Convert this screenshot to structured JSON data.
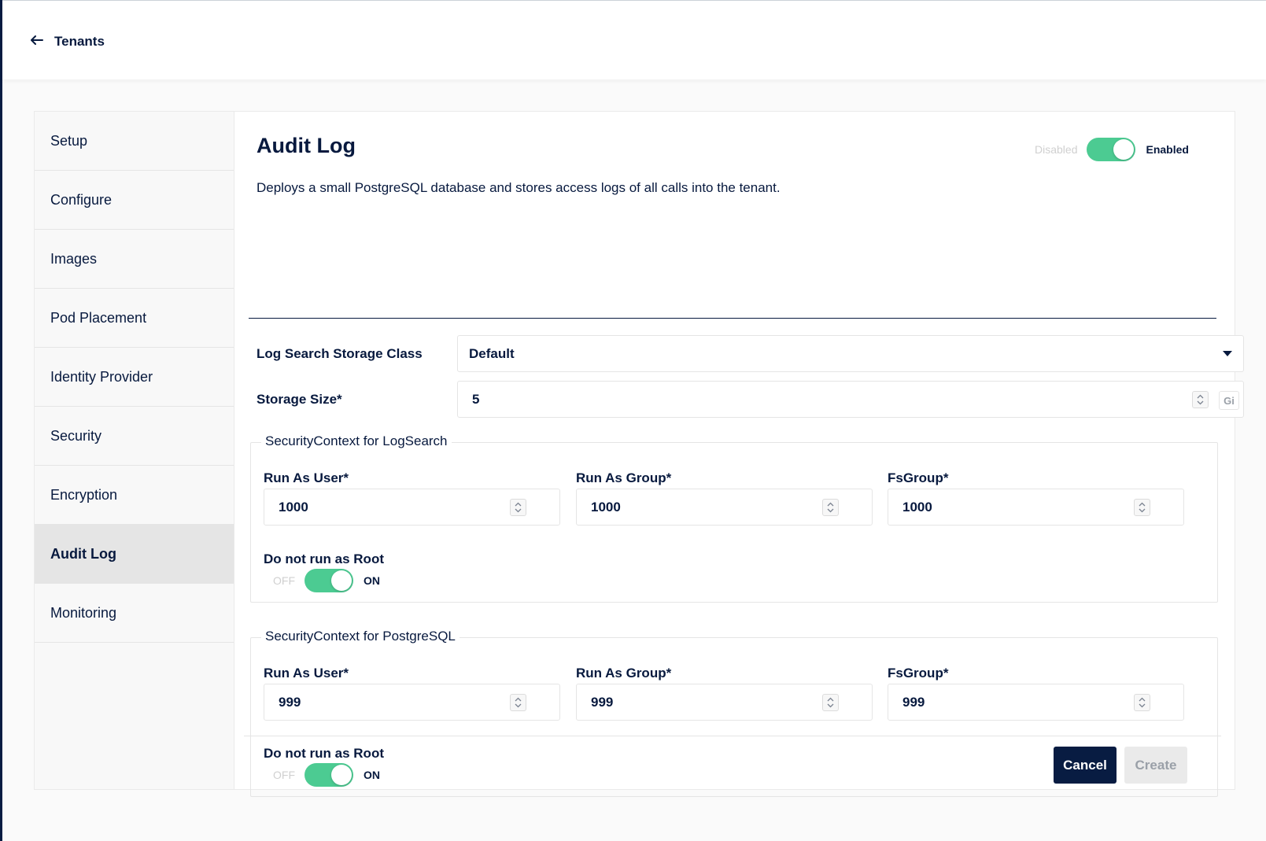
{
  "header": {
    "back_label": "Tenants"
  },
  "sidebar": {
    "items": [
      {
        "label": "Setup"
      },
      {
        "label": "Configure"
      },
      {
        "label": "Images"
      },
      {
        "label": "Pod Placement"
      },
      {
        "label": "Identity Provider"
      },
      {
        "label": "Security"
      },
      {
        "label": "Encryption"
      },
      {
        "label": "Audit Log",
        "active": true
      },
      {
        "label": "Monitoring"
      }
    ]
  },
  "main": {
    "title": "Audit Log",
    "description": "Deploys a small PostgreSQL database and stores access logs of all calls into the tenant.",
    "enable_toggle": {
      "off_label": "Disabled",
      "on_label": "Enabled",
      "value": true
    },
    "storage_class": {
      "label": "Log Search Storage Class",
      "value": "Default"
    },
    "storage_size": {
      "label": "Storage Size*",
      "value": "5",
      "unit": "Gi"
    },
    "logsearch_context": {
      "legend": "SecurityContext for LogSearch",
      "run_as_user": {
        "label": "Run As User*",
        "value": "1000"
      },
      "run_as_group": {
        "label": "Run As Group*",
        "value": "1000"
      },
      "fs_group": {
        "label": "FsGroup*",
        "value": "1000"
      },
      "non_root": {
        "label": "Do not run as Root",
        "off_label": "OFF",
        "on_label": "ON",
        "value": true
      }
    },
    "postgres_context": {
      "legend": "SecurityContext for PostgreSQL",
      "run_as_user": {
        "label": "Run As User*",
        "value": "999"
      },
      "run_as_group": {
        "label": "Run As Group*",
        "value": "999"
      },
      "fs_group": {
        "label": "FsGroup*",
        "value": "999"
      },
      "non_root": {
        "label": "Do not run as Root",
        "off_label": "OFF",
        "on_label": "ON",
        "value": true
      }
    }
  },
  "footer": {
    "cancel_label": "Cancel",
    "create_label": "Create"
  },
  "colors": {
    "navy": "#07193e",
    "accent_green": "#4ccb92",
    "button_dark": "#081c42",
    "disabled_bg": "#eaeaea"
  }
}
